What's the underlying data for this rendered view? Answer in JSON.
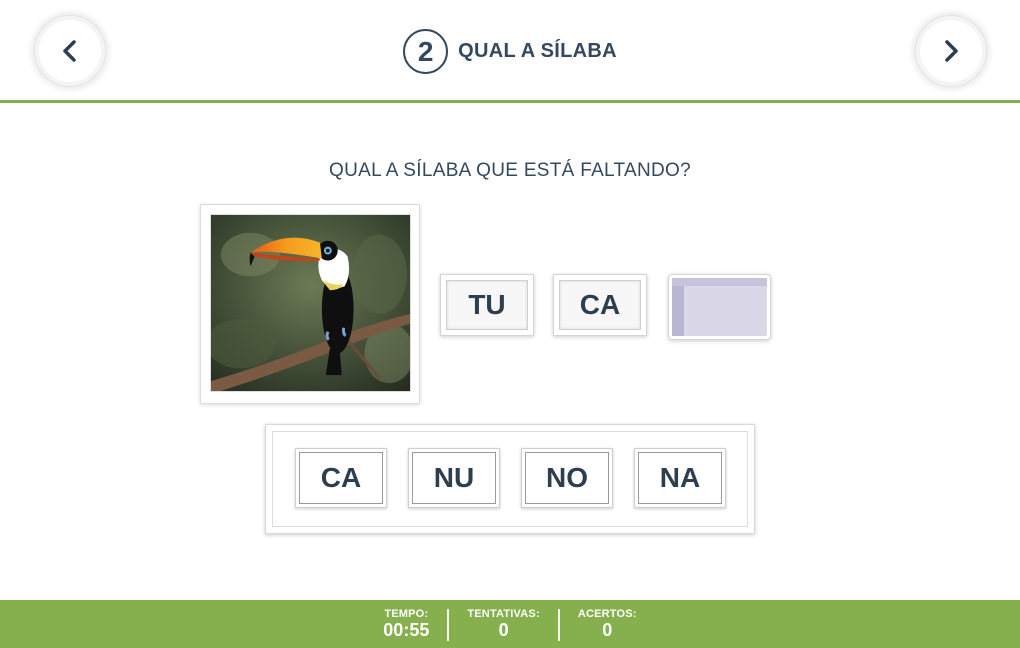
{
  "header": {
    "step_number": "2",
    "title": "QUAL A SÍLABA",
    "prev_icon": "chevron-left-icon",
    "next_icon": "chevron-right-icon"
  },
  "question": "QUAL A SÍLABA QUE ESTÁ FALTANDO?",
  "image": {
    "subject": "toucan-photo"
  },
  "word_syllables": [
    "TU",
    "CA",
    ""
  ],
  "options": [
    "CA",
    "NU",
    "NO",
    "NA"
  ],
  "footer": {
    "time_label": "TEMPO:",
    "time_value": "00:55",
    "attempts_label": "TENTATIVAS:",
    "attempts_value": "0",
    "hits_label": "ACERTOS:",
    "hits_value": "0"
  },
  "colors": {
    "accent_green": "#86b04e",
    "text_dark": "#34495e",
    "empty_slot": "#d9d7e8"
  }
}
